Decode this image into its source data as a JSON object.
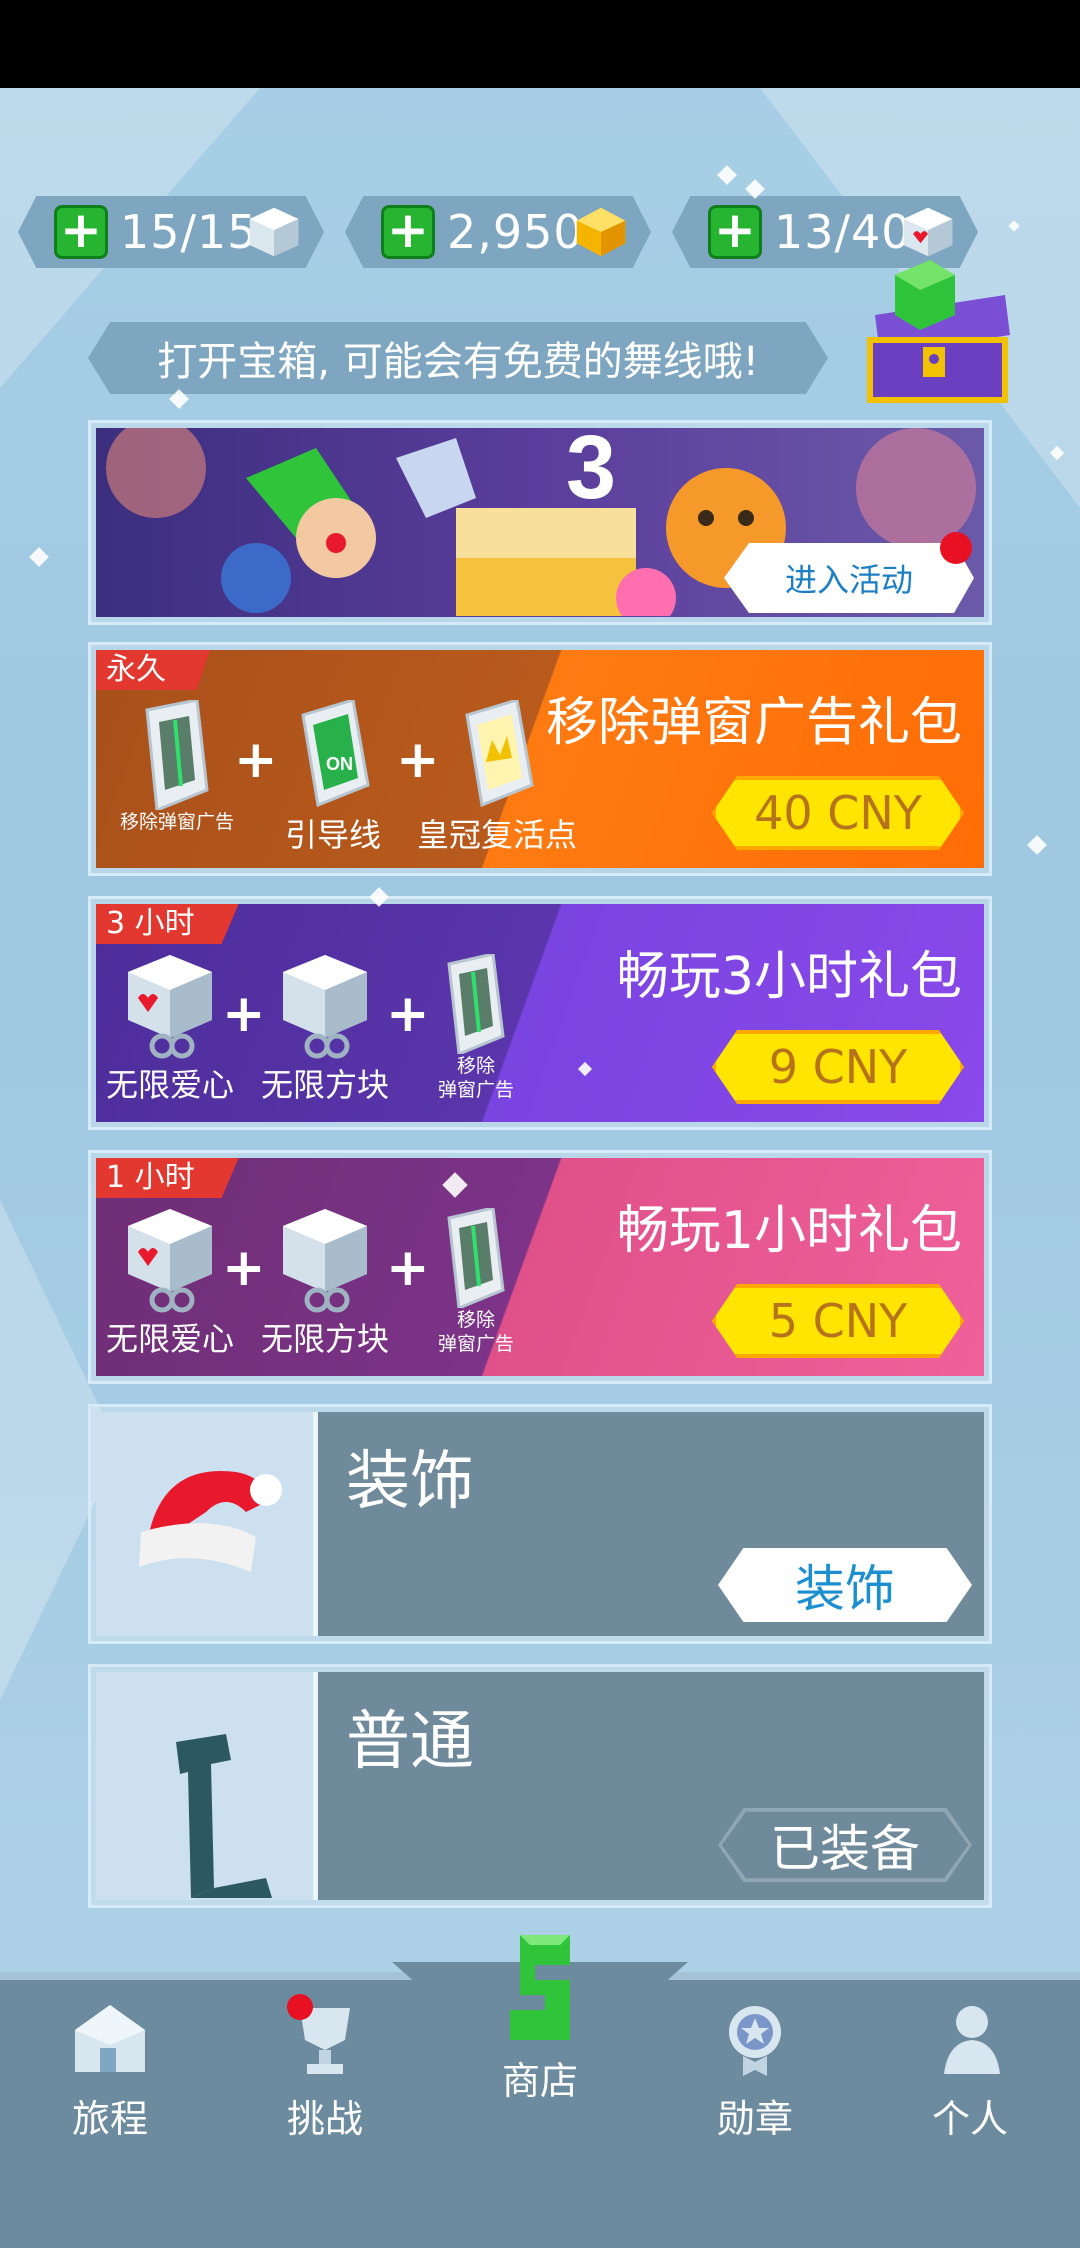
{
  "currencies": [
    {
      "name": "blocks",
      "value": "15/15",
      "icon": "cube-icon"
    },
    {
      "name": "gems",
      "value": "2,950",
      "icon": "gold-gem-icon"
    },
    {
      "name": "hearts",
      "value": "13/40",
      "icon": "heart-cube-icon"
    }
  ],
  "tip": {
    "text": "打开宝箱, 可能会有免费的舞线哦!"
  },
  "event": {
    "button": "进入活动"
  },
  "packs": [
    {
      "tag": "永久",
      "title": "移除弹窗广告礼包",
      "price": "40 CNY",
      "items": [
        "移除弹窗广告",
        "引导线",
        "皇冠复活点"
      ]
    },
    {
      "tag": "3 小时",
      "title": "畅玩3小时礼包",
      "price": "9 CNY",
      "items": [
        "无限爱心",
        "无限方块",
        "移除",
        "弹窗广告"
      ]
    },
    {
      "tag": "1 小时",
      "title": "畅玩1小时礼包",
      "price": "5 CNY",
      "items": [
        "无限爱心",
        "无限方块",
        "移除",
        "弹窗广告"
      ]
    }
  ],
  "skins": [
    {
      "title": "装饰",
      "button": "装饰"
    },
    {
      "title": "普通",
      "button": "已装备"
    }
  ],
  "nav": [
    {
      "label": "旅程",
      "icon": "house-icon"
    },
    {
      "label": "挑战",
      "icon": "trophy-icon"
    },
    {
      "label": "商店",
      "icon": "shop-s-icon"
    },
    {
      "label": "勋章",
      "icon": "medal-icon"
    },
    {
      "label": "个人",
      "icon": "person-icon"
    }
  ],
  "colors": {
    "orange": "#ff6d06",
    "purple": "#8a49ea",
    "pink": "#f0609a",
    "nav": "#6d8b9e",
    "price": "#ffe500"
  }
}
